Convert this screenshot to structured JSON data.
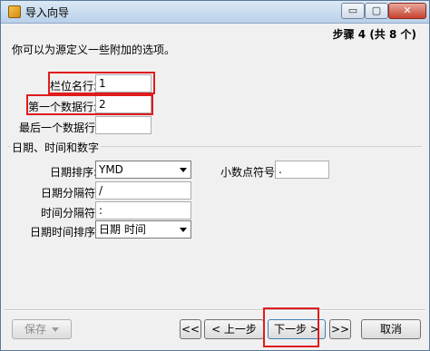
{
  "window": {
    "title": "导入向导"
  },
  "titlebar_controls": {
    "minimize": "▭",
    "maximize": "▢",
    "close": "✕"
  },
  "step": "步骤 4 (共 8 个)",
  "intro": "你可以为源定义一些附加的选项。",
  "fields": {
    "field_name_row": {
      "label": "栏位名行:",
      "value": "1"
    },
    "first_data_row": {
      "label": "第一个数据行:",
      "value": "2"
    },
    "last_data_row": {
      "label": "最后一个数据行:",
      "value": ""
    }
  },
  "datetime_group": {
    "title": "日期、时间和数字",
    "date_order": {
      "label": "日期排序:",
      "value": "YMD"
    },
    "date_delimiter": {
      "label": "日期分隔符:",
      "value": "/"
    },
    "time_delimiter": {
      "label": "时间分隔符:",
      "value": ":"
    },
    "datetime_order": {
      "label": "日期时间排序:",
      "value": "日期 时间"
    },
    "decimal_symbol": {
      "label": "小数点符号:",
      "value": "."
    }
  },
  "buttons": {
    "save": "保存",
    "first": "<<",
    "back": "< 上一步",
    "next": "下一步 >",
    "last": ">>",
    "cancel": "取消"
  },
  "colors": {
    "highlight": "#e01c1c"
  }
}
